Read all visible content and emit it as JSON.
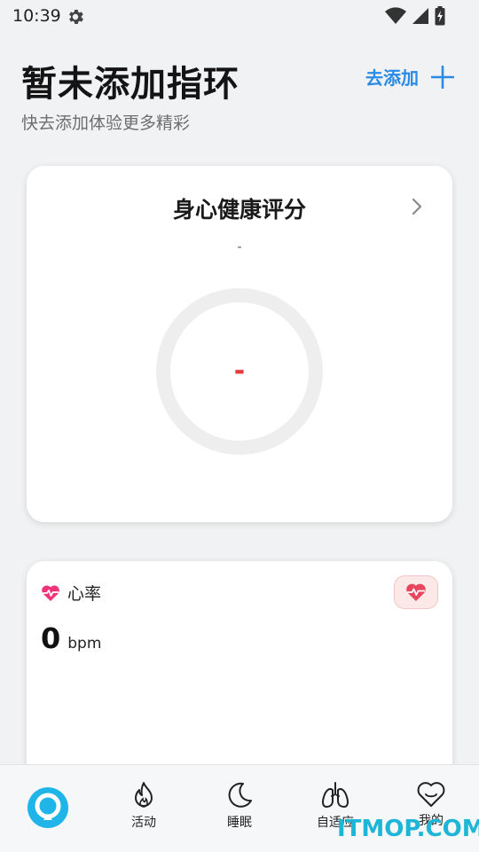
{
  "status_bar": {
    "time": "10:39",
    "icons": [
      "gear-icon",
      "wifi-icon",
      "signal-icon",
      "battery-icon"
    ]
  },
  "header": {
    "title": "暂未添加指环",
    "subtitle": "快去添加体验更多精彩",
    "add_label": "去添加",
    "accent_color": "#2a8be6"
  },
  "score_card": {
    "title": "身心健康评分",
    "subtitle": "-",
    "value": "-",
    "value_color": "#e23b3b"
  },
  "heart_rate": {
    "title": "心率",
    "value": "0",
    "unit": "bpm",
    "icon": "heart-pulse-icon"
  },
  "bottom_nav": {
    "items": [
      {
        "icon": "home-ring-icon",
        "label": ""
      },
      {
        "icon": "flame-icon",
        "label": "活动"
      },
      {
        "icon": "moon-icon",
        "label": "睡眠"
      },
      {
        "icon": "lungs-icon",
        "label": "自适应"
      },
      {
        "icon": "heart-smile-icon",
        "label": "我的"
      }
    ]
  },
  "watermark": "ITMOP.COM"
}
